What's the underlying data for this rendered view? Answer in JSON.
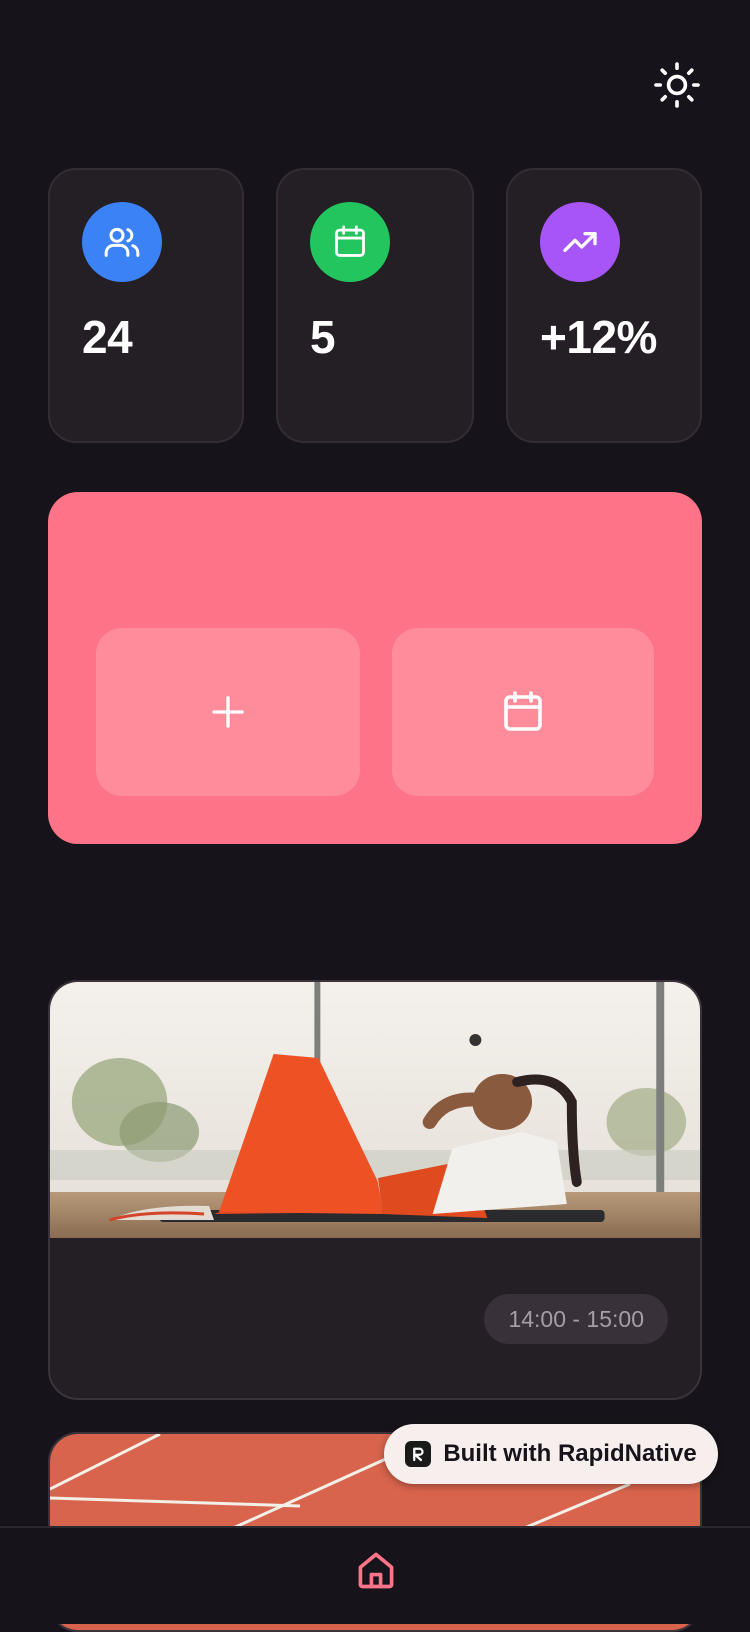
{
  "header": {
    "theme_toggle_icon": "sun-icon"
  },
  "stats": [
    {
      "icon": "users-icon",
      "color": "#3b82f6",
      "value": "24"
    },
    {
      "icon": "calendar-icon",
      "color": "#22c55e",
      "value": "5"
    },
    {
      "icon": "trending-up-icon",
      "color": "#a855f7",
      "value": "+12%"
    }
  ],
  "quick_actions": {
    "panel_color": "#fd7387",
    "buttons": [
      {
        "icon": "plus-icon"
      },
      {
        "icon": "calendar-icon"
      }
    ]
  },
  "sessions": [
    {
      "image": "woman-doing-crunches-photo",
      "time": "14:00 - 15:00"
    },
    {
      "image": "running-track-lanes-photo"
    }
  ],
  "badge": {
    "label": "Built with RapidNative",
    "icon": "rapidnative-logo-icon"
  },
  "bottom_nav": {
    "items": [
      {
        "icon": "home-icon",
        "active_color": "#fd7387"
      }
    ]
  }
}
